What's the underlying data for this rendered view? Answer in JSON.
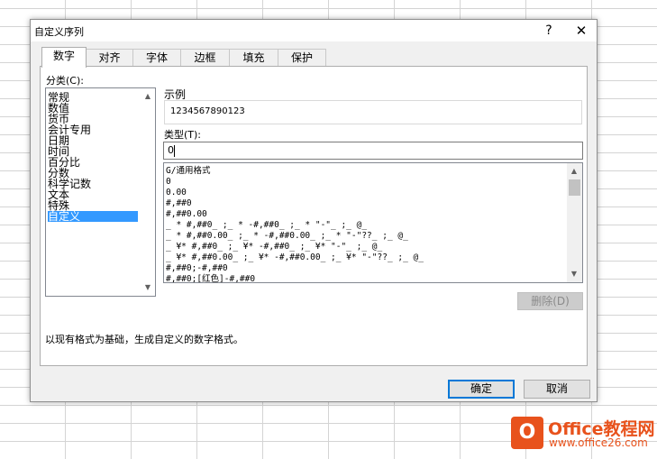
{
  "dialog": {
    "title": "自定义序列",
    "help_icon": "?",
    "close_icon": "✕",
    "tabs": [
      {
        "label": "数字",
        "active": true
      },
      {
        "label": "对齐",
        "active": false
      },
      {
        "label": "字体",
        "active": false
      },
      {
        "label": "边框",
        "active": false
      },
      {
        "label": "填充",
        "active": false
      },
      {
        "label": "保护",
        "active": false
      }
    ],
    "category_label": "分类(C):",
    "categories": [
      "常规",
      "数值",
      "货币",
      "会计专用",
      "日期",
      "时间",
      "百分比",
      "分数",
      "科学记数",
      "文本",
      "特殊",
      "自定义"
    ],
    "selected_category": "自定义",
    "sample_label": "示例",
    "sample_value": "1234567890123",
    "type_label": "类型(T):",
    "type_value": "0",
    "formats": [
      "G/通用格式",
      "0",
      "0.00",
      "#,##0",
      "#,##0.00",
      "_ * #,##0_ ;_ * -#,##0_ ;_ * \"-\"_ ;_ @_ ",
      "_ * #,##0.00_ ;_ * -#,##0.00_ ;_ * \"-\"??_ ;_ @_ ",
      "_ ¥* #,##0_ ;_ ¥* -#,##0_ ;_ ¥* \"-\"_ ;_ @_ ",
      "_ ¥* #,##0.00_ ;_ ¥* -#,##0.00_ ;_ ¥* \"-\"??_ ;_ @_ ",
      "#,##0;-#,##0",
      "#,##0;[红色]-#,##0"
    ],
    "delete_button": "删除(D)",
    "description": "以现有格式为基础，生成自定义的数字格式。",
    "ok_button": "确定",
    "cancel_button": "取消"
  },
  "watermark": {
    "logo_letter": "O",
    "name": "Office教程网",
    "url": "www.office26.com"
  },
  "colors": {
    "selection": "#3399ff",
    "ok_border": "#0078d7",
    "watermark": "#e8521c"
  }
}
